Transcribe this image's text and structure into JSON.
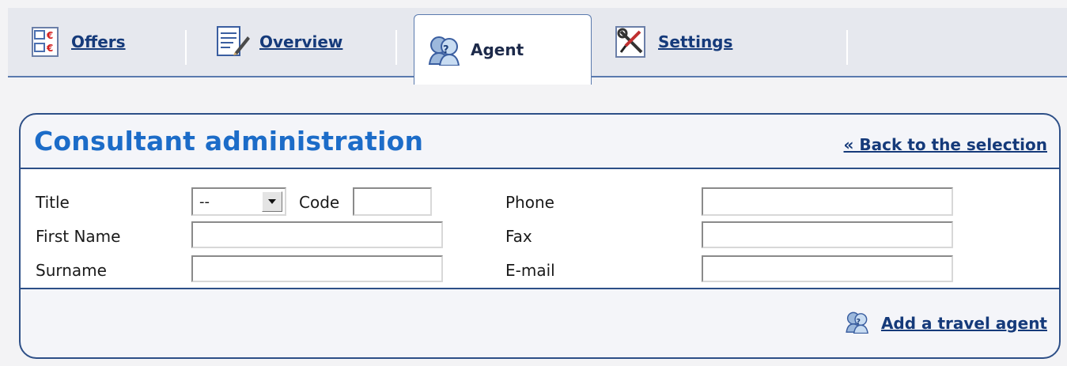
{
  "tabs": [
    {
      "label": "Offers",
      "icon": "offers-icon",
      "active": false
    },
    {
      "label": "Overview",
      "icon": "overview-icon",
      "active": false
    },
    {
      "label": "Agent",
      "icon": "agent-icon",
      "active": true
    },
    {
      "label": "Settings",
      "icon": "settings-icon",
      "active": false
    }
  ],
  "panel": {
    "title": "Consultant administration",
    "back_link": "« Back to the selection"
  },
  "form": {
    "title_label": "Title",
    "title_selected": "--",
    "code_label": "Code",
    "code_value": "",
    "first_name_label": "First Name",
    "first_name_value": "",
    "surname_label": "Surname",
    "surname_value": "",
    "phone_label": "Phone",
    "phone_value": "",
    "fax_label": "Fax",
    "fax_value": "",
    "email_label": "E-mail",
    "email_value": ""
  },
  "footer": {
    "add_agent_label": "Add a travel agent"
  },
  "colors": {
    "link": "#153a7a",
    "title": "#1c6cc8",
    "border": "#2d4f87"
  }
}
